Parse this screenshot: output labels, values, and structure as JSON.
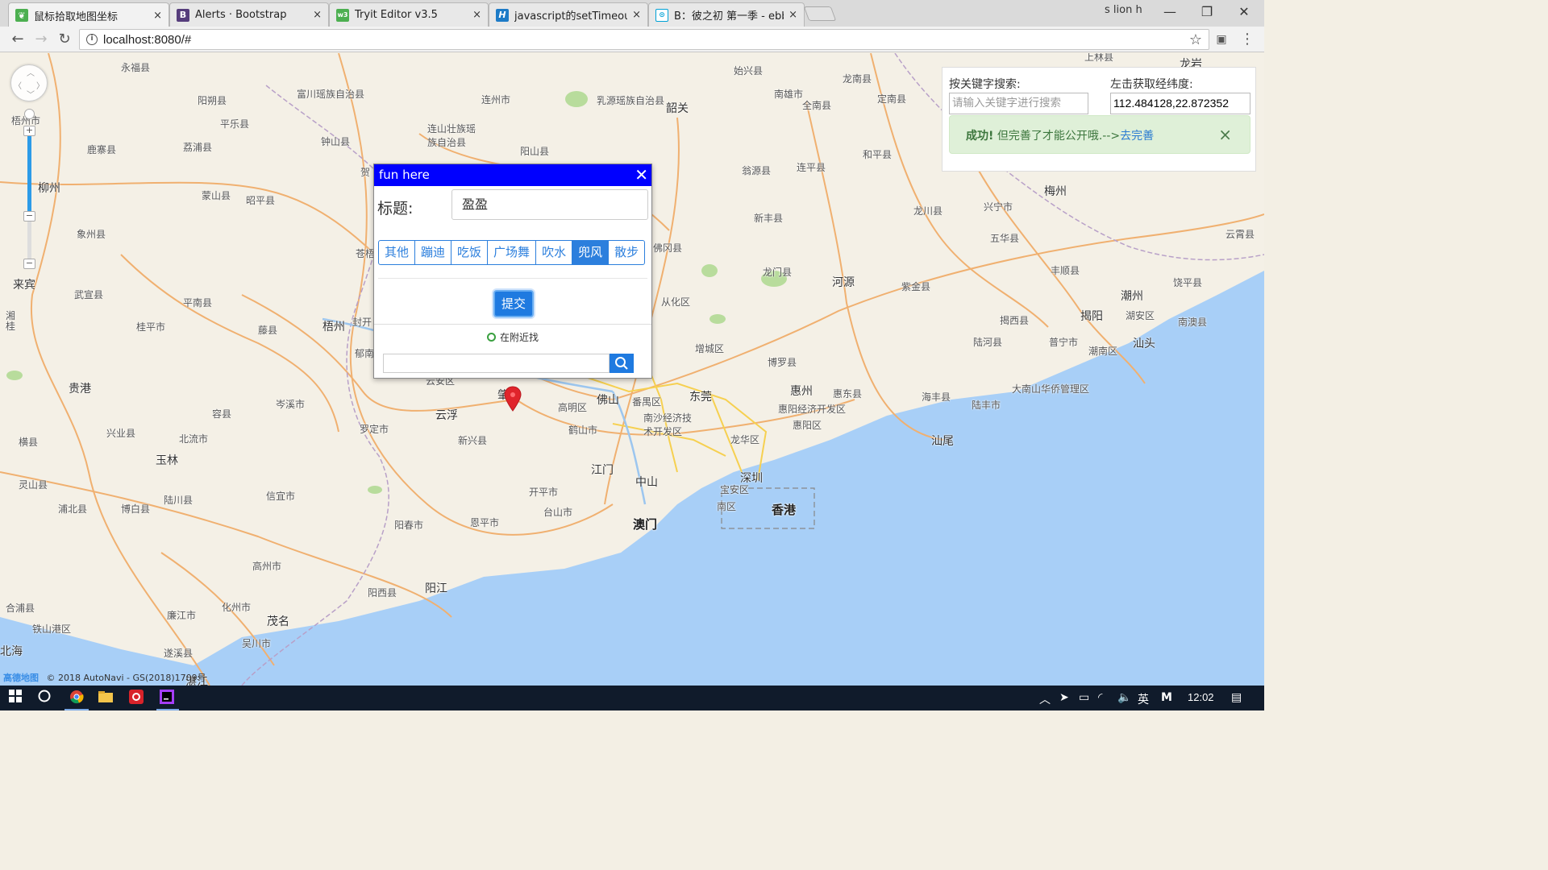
{
  "browser": {
    "tabs": [
      {
        "label": "鼠标拾取地图坐标",
        "icon": "leaf-icon",
        "color": "#4caf50"
      },
      {
        "label": "Alerts · Bootstrap",
        "icon": "bootstrap-icon",
        "color": "#563d7c"
      },
      {
        "label": "Tryit Editor v3.5",
        "icon": "w3schools-icon",
        "color": "#4CAF50"
      },
      {
        "label": "javascript的setTimeout",
        "icon": "h-icon",
        "color": "#1d7bc7"
      },
      {
        "label": "B：彼之初 第一季 - ebb",
        "icon": "bilibili-icon",
        "color": "#00a1d6"
      }
    ],
    "user": "s lion h",
    "url": "localhost:8080/#",
    "close_glyph": "×"
  },
  "map": {
    "credit_logo": "高德地图",
    "credit_text": "© 2018 AutoNavi - GS(2018)1709号",
    "labels": [
      {
        "t": "永福县"
      },
      {
        "t": "富川瑶族自治县"
      },
      {
        "t": "连州市"
      },
      {
        "t": "乳源瑶族自治县"
      },
      {
        "t": "始兴县"
      },
      {
        "t": "南雄市"
      },
      {
        "t": "龙南县"
      },
      {
        "t": "定南县"
      },
      {
        "t": "阳朔县"
      },
      {
        "t": "平乐县"
      },
      {
        "t": "连山壮族瑶族自治县"
      },
      {
        "t": "钟山县"
      },
      {
        "t": "阳山县"
      },
      {
        "t": "韶关"
      },
      {
        "t": "全南县"
      },
      {
        "t": "和平县"
      },
      {
        "t": "鹿寨县"
      },
      {
        "t": "荔浦县"
      },
      {
        "t": "柳州"
      },
      {
        "t": "蒙山县"
      },
      {
        "t": "昭平县"
      },
      {
        "t": "翁源县"
      },
      {
        "t": "连平县"
      },
      {
        "t": "梅州"
      },
      {
        "t": "象州县"
      },
      {
        "t": "新丰县"
      },
      {
        "t": "龙川县"
      },
      {
        "t": "兴宁市"
      },
      {
        "t": "五华县"
      },
      {
        "t": "云霄县"
      },
      {
        "t": "佛冈县"
      },
      {
        "t": "来宾"
      },
      {
        "t": "武宣县"
      },
      {
        "t": "平南县"
      },
      {
        "t": "桂平市"
      },
      {
        "t": "藤县"
      },
      {
        "t": "梧州"
      },
      {
        "t": "龙门县"
      },
      {
        "t": "河源"
      },
      {
        "t": "紫金县"
      },
      {
        "t": "丰顺县"
      },
      {
        "t": "潮州"
      },
      {
        "t": "饶平县"
      },
      {
        "t": "从化区"
      },
      {
        "t": "揭阳"
      },
      {
        "t": "揭西县"
      },
      {
        "t": "湖安区"
      },
      {
        "t": "南澳县"
      },
      {
        "t": "汕头"
      },
      {
        "t": "增城区"
      },
      {
        "t": "博罗县"
      },
      {
        "t": "陆河县"
      },
      {
        "t": "普宁市"
      },
      {
        "t": "潮南区"
      },
      {
        "t": "贵港"
      },
      {
        "t": "云安区"
      },
      {
        "t": "云浮"
      },
      {
        "t": "佛山"
      },
      {
        "t": "东莞"
      },
      {
        "t": "惠州"
      },
      {
        "t": "惠东县"
      },
      {
        "t": "海丰县"
      },
      {
        "t": "陆丰市"
      },
      {
        "t": "大南山华侨管理区"
      },
      {
        "t": "岑溪市"
      },
      {
        "t": "容县"
      },
      {
        "t": "罗定市"
      },
      {
        "t": "高明区"
      },
      {
        "t": "番禺区"
      },
      {
        "t": "南沙经济技术开发区"
      },
      {
        "t": "惠阳经济开发区"
      },
      {
        "t": "惠阳区"
      },
      {
        "t": "汕尾"
      },
      {
        "t": "兴业县"
      },
      {
        "t": "北流市"
      },
      {
        "t": "新兴县"
      },
      {
        "t": "鹤山市"
      },
      {
        "t": "龙华区"
      },
      {
        "t": "横县"
      },
      {
        "t": "玉林"
      },
      {
        "t": "江门"
      },
      {
        "t": "中山"
      },
      {
        "t": "深圳"
      },
      {
        "t": "宝安区"
      },
      {
        "t": "开平市"
      },
      {
        "t": "信宜市"
      },
      {
        "t": "灵山县"
      },
      {
        "t": "陆川县"
      },
      {
        "t": "浦北县"
      },
      {
        "t": "博白县"
      },
      {
        "t": "恩平市"
      },
      {
        "t": "台山市"
      },
      {
        "t": "香港"
      },
      {
        "t": "南区"
      },
      {
        "t": "澳门"
      },
      {
        "t": "阳春市"
      },
      {
        "t": "高州市"
      },
      {
        "t": "阳江"
      },
      {
        "t": "阳西县"
      },
      {
        "t": "合浦县"
      },
      {
        "t": "铁山港区"
      },
      {
        "t": "化州市"
      },
      {
        "t": "廉江市"
      },
      {
        "t": "茂名"
      },
      {
        "t": "北海"
      },
      {
        "t": "吴川市"
      },
      {
        "t": "遂溪县"
      },
      {
        "t": "湛江"
      },
      {
        "t": "湘桂"
      },
      {
        "t": "封开"
      },
      {
        "t": "郁南"
      },
      {
        "t": "贺"
      },
      {
        "t": "苍梧"
      },
      {
        "t": "肇庆"
      },
      {
        "t": "梧州市"
      },
      {
        "t": "上林县"
      },
      {
        "t": "龙岩"
      }
    ]
  },
  "sidepanel": {
    "keyword_label": "按关键字搜索:",
    "keyword_placeholder": "请输入关键字进行搜索",
    "coord_label": "左击获取经纬度:",
    "coord_value": "112.484128,22.872352",
    "alert_strong": "成功!",
    "alert_text": " 但完善了才能公开哦.-->",
    "alert_link": "去完善",
    "alert_close": "×"
  },
  "infowindow": {
    "header": "fun here",
    "close": "✕",
    "title_label": "标题:",
    "title_value": "盈盈",
    "categories": [
      {
        "label": "其他",
        "active": false
      },
      {
        "label": "蹦迪",
        "active": false
      },
      {
        "label": "吃饭",
        "active": false
      },
      {
        "label": "广场舞",
        "active": false
      },
      {
        "label": "吹水",
        "active": false
      },
      {
        "label": "兜风",
        "active": true
      },
      {
        "label": "散步",
        "active": false
      }
    ],
    "submit": "提交",
    "nearby": "在附近找",
    "search_value": ""
  },
  "taskbar": {
    "lang": "英",
    "ime": "M",
    "time": "12:02"
  }
}
